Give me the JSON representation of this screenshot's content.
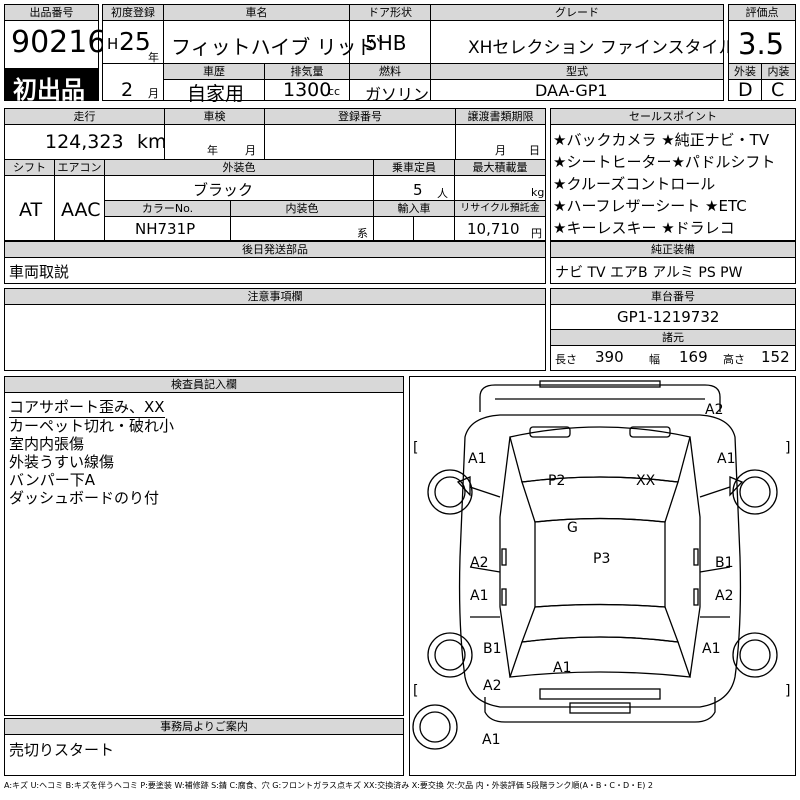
{
  "lot": {
    "label": "出品番号",
    "value": "90216",
    "badge": "初出品"
  },
  "first_reg": {
    "label": "初度登録",
    "era": "H",
    "year": "25",
    "year_unit": "年",
    "month": "2",
    "month_unit": "月"
  },
  "car_name": {
    "label": "車名",
    "value": "フィットハイブ リッド゛"
  },
  "door": {
    "label": "ドア形状",
    "value": "5HB"
  },
  "grade": {
    "label": "グレード",
    "value": "XHセレクション ファインスタイル"
  },
  "score": {
    "label": "評価点",
    "value": "3.5",
    "ext_label": "外装",
    "ext_value": "D",
    "int_label": "内装",
    "int_value": "C"
  },
  "history": {
    "label": "車歴",
    "value": "自家用"
  },
  "displacement": {
    "label": "排気量",
    "value": "1300",
    "unit": "cc"
  },
  "fuel": {
    "label": "燃料",
    "value": "ガソリン"
  },
  "model": {
    "label": "型式",
    "value": "DAA-GP1"
  },
  "mileage": {
    "label": "走行",
    "value": "124,323",
    "unit": "km"
  },
  "inspection": {
    "label": "車検",
    "year_unit": "年",
    "month_unit": "月"
  },
  "reg_no": {
    "label": "登録番号"
  },
  "transfer": {
    "label": "譲渡書類期限",
    "month_unit": "月",
    "day_unit": "日"
  },
  "shift": {
    "label": "シフト",
    "value": "AT"
  },
  "aircon": {
    "label": "エアコン",
    "value": "AAC"
  },
  "ext_color": {
    "label": "外装色",
    "value": "ブラック"
  },
  "capacity": {
    "label": "乗車定員",
    "value": "5",
    "unit": "人"
  },
  "max_load": {
    "label": "最大積載量",
    "unit": "kg"
  },
  "color_no": {
    "label": "カラーNo.",
    "value": "NH731P"
  },
  "int_color": {
    "label": "内装色",
    "suffix": "系"
  },
  "import": {
    "label": "輸入車"
  },
  "recycle": {
    "label": "リサイクル預託金",
    "value": "10,710",
    "unit": "円"
  },
  "sales_points": {
    "label": "セールスポイント",
    "lines": [
      "★バックカメラ ★純正ナビ・TV",
      "★シートヒーター★パドルシフト",
      "★クルーズコントロール",
      "★ハーフレザーシート ★ETC",
      "★キーレスキー ★ドラレコ"
    ]
  },
  "later_parts": {
    "label": "後日発送部品",
    "value": "車両取説"
  },
  "genuine": {
    "label": "純正装備",
    "value": "ナビ TV エアB アルミ PS PW"
  },
  "notes": {
    "label": "注意事項欄"
  },
  "chassis": {
    "label": "車台番号",
    "value": "GP1-1219732"
  },
  "specs": {
    "label": "諸元",
    "length_label": "長さ",
    "length": "390",
    "width_label": "幅",
    "width": "169",
    "height_label": "高さ",
    "height": "152"
  },
  "inspector": {
    "label": "検査員記入欄",
    "lines": [
      "コアサポート歪み、XX",
      "カーペット切れ・破れ小",
      "室内内張傷",
      "外装うすい線傷",
      "バンパー下A",
      "ダッシュボードのり付"
    ]
  },
  "office": {
    "label": "事務局よりご案内",
    "value": "売切りスタート"
  },
  "legend": "A:キズ U:ヘコミ B:キズを伴うヘコミ P:要塗装 W:補修跡 S:錆 C:腐食、穴 G:フロントガラス点キズ XX:交換済み X:要交換 欠:欠品 内・外装評価 5段階ランク順(A・B・C・D・E) 2",
  "diagram_marks": {
    "a2_top": "A2",
    "a1_left_front": "A1",
    "a1_right_front": "A1",
    "p2": "P2",
    "xx": "XX",
    "g": "G",
    "p3": "P3",
    "a2_left_mid": "A2",
    "b1_right_mid": "B1",
    "a1_left_rear": "A1",
    "a2_right_rear": "A2",
    "b1_left_back": "B1",
    "a1_right_back": "A1",
    "a1_center_back": "A1",
    "a2_left_bottom": "A2",
    "a1_spare": "A1",
    "bracket_l1": "[",
    "bracket_r1": "]",
    "bracket_l2": "[",
    "bracket_r2": "]"
  }
}
